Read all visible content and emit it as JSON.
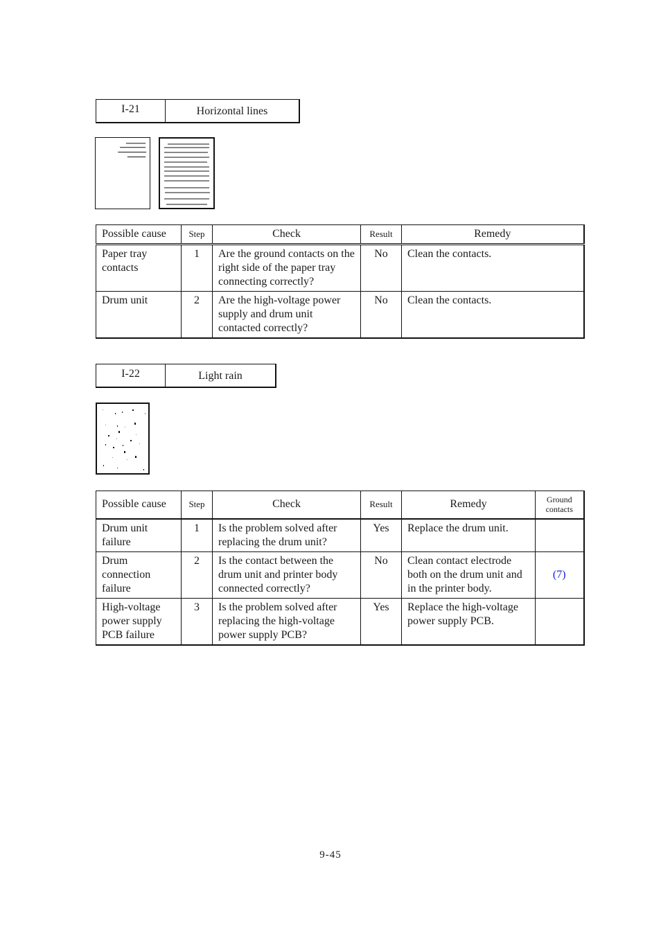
{
  "sections": [
    {
      "code": "I-21",
      "title": "Horizontal lines",
      "images": [
        "horizontal-lines-partial-sample",
        "horizontal-lines-full-sample"
      ],
      "table": {
        "headers": {
          "cause": "Possible cause",
          "step": "Step",
          "check": "Check",
          "result": "Result",
          "remedy": "Remedy"
        },
        "rows": [
          {
            "cause": "Paper tray contacts",
            "step": "1",
            "check": "Are the ground contacts on the right side of the paper tray connecting correctly?",
            "result": "No",
            "remedy": "Clean the contacts."
          },
          {
            "cause": "Drum unit",
            "step": "2",
            "check": "Are the high-voltage power supply and drum unit contacted correctly?",
            "result": "No",
            "remedy": "Clean the contacts."
          }
        ]
      }
    },
    {
      "code": "I-22",
      "title": "Light rain",
      "images": [
        "light-rain-sample"
      ],
      "table": {
        "headers": {
          "cause": "Possible cause",
          "step": "Step",
          "check": "Check",
          "result": "Result",
          "remedy": "Remedy",
          "ground": "Ground contacts"
        },
        "rows": [
          {
            "cause": "Drum unit failure",
            "step": "1",
            "check": "Is the problem solved after replacing the drum unit?",
            "result": "Yes",
            "remedy": "Replace the drum unit.",
            "ground": ""
          },
          {
            "cause": "Drum connection failure",
            "step": "2",
            "check": "Is the contact between the drum unit and printer body connected correctly?",
            "result": "No",
            "remedy": "Clean contact electrode both on the drum unit and in the printer body.",
            "ground": "(7)"
          },
          {
            "cause": "High-voltage power supply PCB failure",
            "step": "3",
            "check": "Is the problem solved after replacing the high-voltage power supply PCB?",
            "result": "Yes",
            "remedy": "Replace the high-voltage power supply PCB.",
            "ground": ""
          }
        ]
      }
    }
  ],
  "colors": {
    "link": "#1a1adb",
    "text": "#1a1a1a"
  },
  "footer": {
    "page_number": "9-45"
  }
}
